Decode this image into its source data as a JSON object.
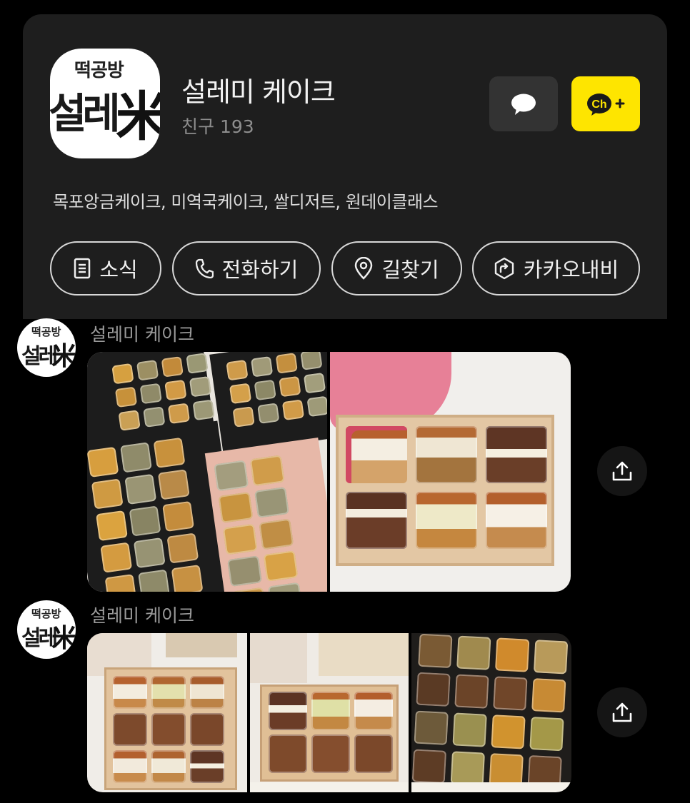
{
  "profile": {
    "logo_top": "떡공방",
    "logo_main": "설레",
    "logo_rice": "米",
    "name": "설레미 케이크",
    "friends": "친구 193",
    "description": "목포앙금케이크, 미역국케이크, 쌀디저트, 원데이클래스",
    "chat_icon": "speech-bubble-icon",
    "channel_add": "Ch+",
    "actions": [
      {
        "label": "소식",
        "icon": "news-icon"
      },
      {
        "label": "전화하기",
        "icon": "phone-icon"
      },
      {
        "label": "길찾기",
        "icon": "location-pin-icon"
      },
      {
        "label": "카카오내비",
        "icon": "navi-icon"
      }
    ]
  },
  "posts": [
    {
      "author": "설레미 케이크",
      "avatar_top": "떡공방",
      "avatar_main": "설레",
      "avatar_rice": "米"
    },
    {
      "author": "설레미 케이크",
      "avatar_top": "떡공방",
      "avatar_main": "설레",
      "avatar_rice": "米"
    }
  ],
  "colors": {
    "background": "#000000",
    "card": "#1e1e1e",
    "kakao_yellow": "#fee500"
  }
}
